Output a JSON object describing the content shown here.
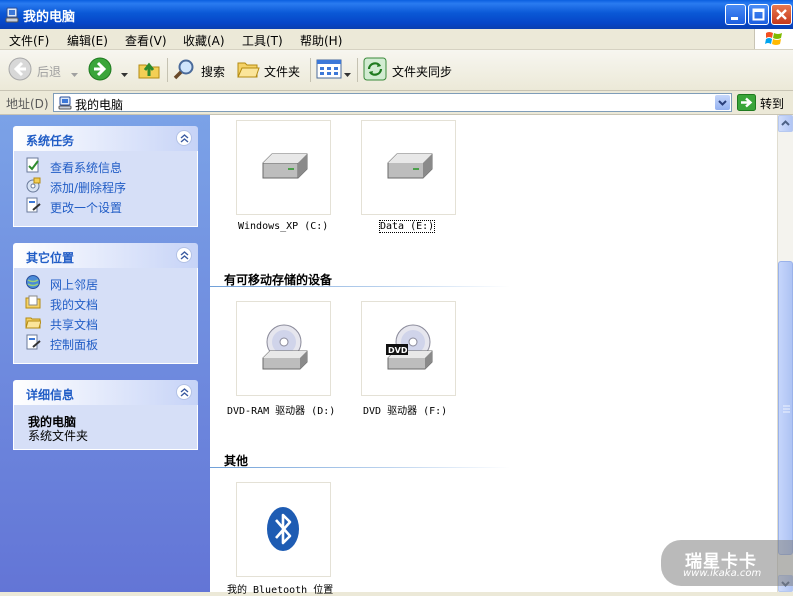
{
  "window": {
    "title": "我的电脑"
  },
  "menu": [
    {
      "label": "文件(F)"
    },
    {
      "label": "编辑(E)"
    },
    {
      "label": "查看(V)"
    },
    {
      "label": "收藏(A)"
    },
    {
      "label": "工具(T)"
    },
    {
      "label": "帮助(H)"
    }
  ],
  "toolbar": {
    "back": "后退",
    "search": "搜索",
    "folders": "文件夹",
    "sync": "文件夹同步"
  },
  "address": {
    "label": "地址(D)",
    "value": "我的电脑",
    "go": "转到"
  },
  "panels": {
    "system_tasks": {
      "title": "系统任务",
      "items": [
        "查看系统信息",
        "添加/删除程序",
        "更改一个设置"
      ]
    },
    "other_places": {
      "title": "其它位置",
      "items": [
        "网上邻居",
        "我的文档",
        "共享文档",
        "控制面板"
      ]
    },
    "details": {
      "title": "详细信息",
      "name": "我的电脑",
      "desc": "系统文件夹"
    }
  },
  "content": {
    "hard_drives": [
      {
        "label": "Windows_XP (C:)"
      },
      {
        "label": "Data (E:)"
      }
    ],
    "removable_title": "有可移动存储的设备",
    "removable": [
      {
        "label": "DVD-RAM 驱动器 (D:)"
      },
      {
        "label": "DVD 驱动器 (F:)",
        "badge": "DVD"
      }
    ],
    "other_title": "其他",
    "other": [
      {
        "label": "我的 Bluetooth 位置"
      }
    ]
  },
  "watermark": {
    "text": "瑞星卡卡",
    "url": "www.ikaka.com"
  },
  "colors": {
    "title_blue": "#0a58d6",
    "task_link": "#215dc6",
    "pane_bg": "#6f8cde"
  }
}
